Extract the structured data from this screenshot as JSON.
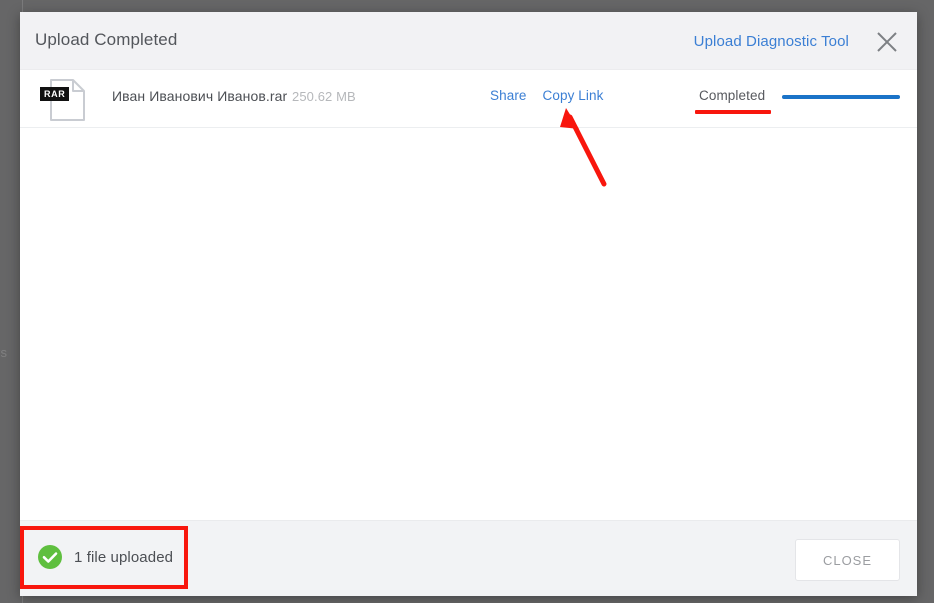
{
  "backdrop": {
    "ghost_text": "rs"
  },
  "dialog": {
    "header": {
      "title": "Upload Completed",
      "diagnostic_link": "Upload Diagnostic Tool",
      "close_icon": "close-icon"
    },
    "file_row": {
      "icon": "rar-file-icon",
      "extension_badge": "RAR",
      "name": "Иван Иванович Иванов.rar",
      "size": "250.62 MB",
      "actions": [
        {
          "label": "Share",
          "name": "share-link"
        },
        {
          "label": "Copy Link",
          "name": "copy-link"
        }
      ],
      "status": "Completed",
      "progress_percent": 100
    },
    "footer": {
      "status_icon": "check-circle-icon",
      "summary": "1 file uploaded",
      "close_button": "CLOSE"
    }
  },
  "colors": {
    "link_blue": "#3b7fd4",
    "progress_blue": "#1a73c8",
    "annotation_red": "#f8160d",
    "success_green": "#5fbf3f",
    "header_gray": "#f2f2f4",
    "backdrop_gray": "#666667"
  },
  "annotations": {
    "underline_target": "Completed",
    "box_target": "1 file uploaded",
    "arrow_target": "Copy Link"
  }
}
